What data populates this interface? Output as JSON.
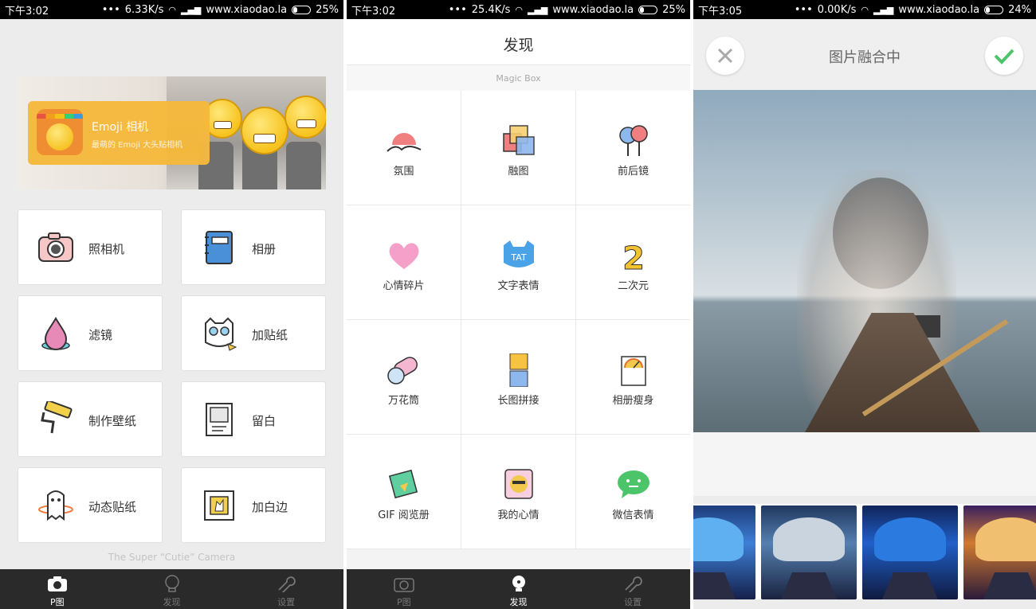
{
  "panel1": {
    "status": {
      "time": "下午3:02",
      "speed": "6.33K/s",
      "site": "www.xiaodao.la",
      "battery": "25%"
    },
    "banner": {
      "title": "Emoji 相机",
      "subtitle": "最萌的 Emoji 大头贴相机"
    },
    "grid": [
      {
        "label": "照相机",
        "icon": "camera-icon"
      },
      {
        "label": "相册",
        "icon": "album-icon"
      },
      {
        "label": "滤镜",
        "icon": "filter-drop-icon"
      },
      {
        "label": "加贴纸",
        "icon": "cat-sticker-icon"
      },
      {
        "label": "制作壁纸",
        "icon": "paint-roller-icon"
      },
      {
        "label": "留白",
        "icon": "frame-blank-icon"
      },
      {
        "label": "动态贴纸",
        "icon": "ghost-icon"
      },
      {
        "label": "加白边",
        "icon": "white-border-icon"
      }
    ],
    "tagline": "The Super “Cutie” Camera",
    "tabs": [
      "P图",
      "发现",
      "设置"
    ]
  },
  "panel2": {
    "status": {
      "time": "下午3:02",
      "speed": "25.4K/s",
      "site": "www.xiaodao.la",
      "battery": "25%"
    },
    "title": "发现",
    "subtitle": "Magic Box",
    "cells": [
      {
        "label": "氛围",
        "icon": "sunset-icon"
      },
      {
        "label": "融图",
        "icon": "blend-icon"
      },
      {
        "label": "前后镜",
        "icon": "dual-lens-icon"
      },
      {
        "label": "心情碎片",
        "icon": "heart-icon"
      },
      {
        "label": "文字表情",
        "icon": "tat-cat-icon",
        "glyph": "TAT"
      },
      {
        "label": "二次元",
        "icon": "number-two-icon",
        "glyph": "2"
      },
      {
        "label": "万花筒",
        "icon": "kaleidoscope-icon"
      },
      {
        "label": "长图拼接",
        "icon": "long-image-icon"
      },
      {
        "label": "相册瘦身",
        "icon": "album-slim-icon"
      },
      {
        "label": "GIF 阅览册",
        "icon": "gif-album-icon"
      },
      {
        "label": "我的心情",
        "icon": "my-mood-icon"
      },
      {
        "label": "微信表情",
        "icon": "wechat-emoji-icon"
      }
    ],
    "tabs": [
      "P图",
      "发现",
      "设置"
    ]
  },
  "panel3": {
    "status": {
      "time": "下午3:05",
      "speed": "0.00K/s",
      "site": "www.xiaodao.la",
      "battery": "24%"
    },
    "title": "图片融合中",
    "thumbs": [
      {
        "style": "blue-stars"
      },
      {
        "style": "grey-fade"
      },
      {
        "style": "deep-blue"
      },
      {
        "style": "warm-gold"
      }
    ]
  },
  "colors": {
    "accent_green": "#4cc46a",
    "tab_bg": "#2a2a2a",
    "banner_orange": "#f6b93b"
  }
}
